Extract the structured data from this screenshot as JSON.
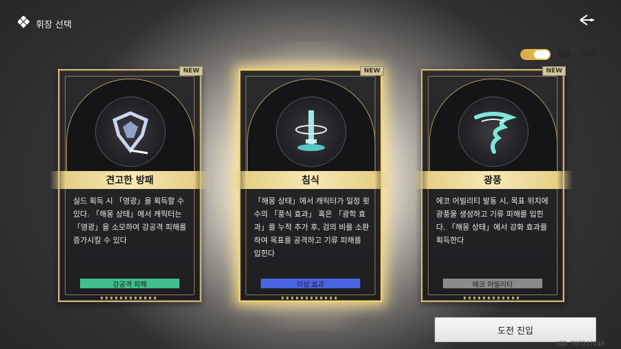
{
  "header": {
    "title": "휘장 선택"
  },
  "toggle": {
    "label": "설명 · 간략"
  },
  "cards": [
    {
      "badge": "NEW",
      "name": "견고한 방패",
      "description": "실드 획득 시 「영광」을 획득할 수 있다. 「해몽 상태」에서 캐릭터는 「영광」을 소모하여 강공격 피해를 증가시킬 수 있다",
      "tag": "강공격 피해",
      "tag_color": "#3fbf90",
      "icon": "shield-emblem-icon"
    },
    {
      "badge": "NEW",
      "name": "침식",
      "description": "「해몽 상태」에서 캐릭터가 일정 횟수의 「풍식 효과」 혹은 「광학 효과」를 누적 추가 후, 검의 비를 소환하여 목표를 공격하고 기류 피해를 입힌다",
      "tag": "이상 효과",
      "tag_color": "#4a63e0",
      "icon": "sword-emblem-icon"
    },
    {
      "badge": "NEW",
      "name": "광풍",
      "description": "에코 어빌리티 발동 시, 목표 위치에 광풍을 생성하고 기류 피해를 입힌다. 「해몽 상태」에서 강화 효과를 획득한다",
      "tag": "에코 어빌리티",
      "tag_color": "#8a8a8a",
      "icon": "whirlwind-emblem-icon"
    }
  ],
  "actions": {
    "start_label": "도전 진입"
  },
  "footer": {
    "uid": "UID 707217248"
  }
}
